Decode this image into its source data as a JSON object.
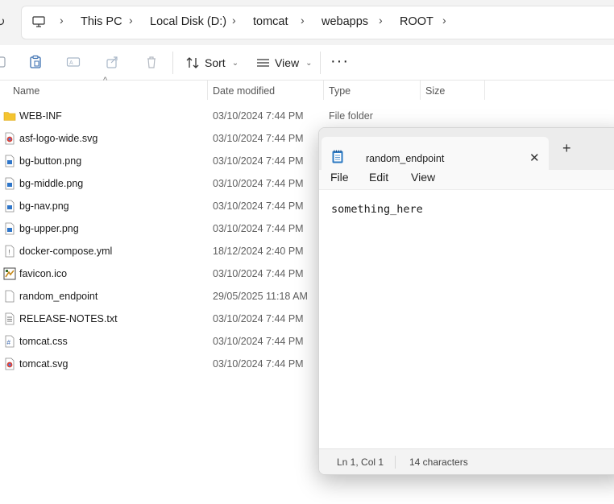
{
  "address_bar": {
    "breadcrumbs": [
      "This PC",
      "Local Disk (D:)",
      "tomcat",
      "webapps",
      "ROOT"
    ]
  },
  "command_bar": {
    "sort_label": "Sort",
    "view_label": "View",
    "more_label": "···"
  },
  "file_list": {
    "columns": [
      "Name",
      "Date modified",
      "Type",
      "Size"
    ],
    "rows": [
      {
        "name": "WEB-INF",
        "date": "03/10/2024 7:44 PM",
        "type": "File folder",
        "icon": "folder-icon"
      },
      {
        "name": "asf-logo-wide.svg",
        "date": "03/10/2024 7:44 PM",
        "type": "",
        "icon": "chrome-svg-icon"
      },
      {
        "name": "bg-button.png",
        "date": "03/10/2024 7:44 PM",
        "type": "",
        "icon": "image-file-icon"
      },
      {
        "name": "bg-middle.png",
        "date": "03/10/2024 7:44 PM",
        "type": "",
        "icon": "image-file-icon"
      },
      {
        "name": "bg-nav.png",
        "date": "03/10/2024 7:44 PM",
        "type": "",
        "icon": "image-file-icon"
      },
      {
        "name": "bg-upper.png",
        "date": "03/10/2024 7:44 PM",
        "type": "",
        "icon": "image-file-icon"
      },
      {
        "name": "docker-compose.yml",
        "date": "18/12/2024 2:40 PM",
        "type": "",
        "icon": "yml-file-icon"
      },
      {
        "name": "favicon.ico",
        "date": "03/10/2024 7:44 PM",
        "type": "",
        "icon": "ico-file-icon"
      },
      {
        "name": "random_endpoint",
        "date": "29/05/2025 11:18 AM",
        "type": "",
        "icon": "blank-file-icon"
      },
      {
        "name": "RELEASE-NOTES.txt",
        "date": "03/10/2024 7:44 PM",
        "type": "",
        "icon": "text-file-icon"
      },
      {
        "name": "tomcat.css",
        "date": "03/10/2024 7:44 PM",
        "type": "",
        "icon": "css-file-icon"
      },
      {
        "name": "tomcat.svg",
        "date": "03/10/2024 7:44 PM",
        "type": "",
        "icon": "chrome-svg-icon"
      }
    ]
  },
  "notepad": {
    "tab_title": "random_endpoint",
    "close_glyph": "✕",
    "new_tab_glyph": "+",
    "menu": [
      "File",
      "Edit",
      "View"
    ],
    "content": "something_here",
    "status": {
      "position": "Ln 1, Col 1",
      "char_count": "14 characters"
    }
  },
  "colors": {
    "folder": "#f4c430",
    "notepad_icon": "#2b79c2",
    "address_bg": "#f3f3f3"
  }
}
